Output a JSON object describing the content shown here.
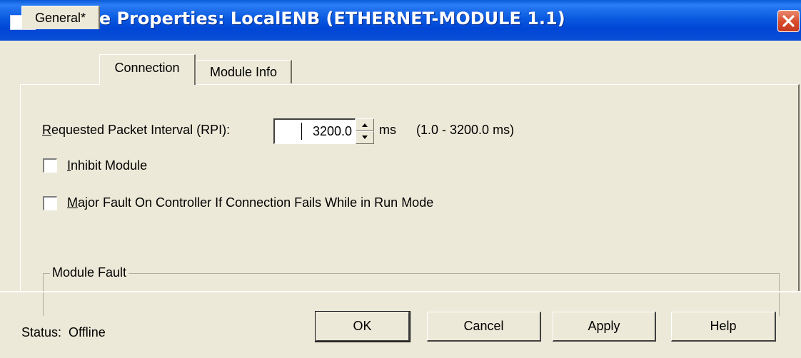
{
  "window": {
    "title": "Module Properties: LocalENB (ETHERNET-MODULE 1.1)"
  },
  "tabs": [
    {
      "label": "General*"
    },
    {
      "label": "Connection"
    },
    {
      "label": "Module Info"
    }
  ],
  "connection": {
    "rpi_label_mnemonic": "R",
    "rpi_label_rest": "equested Packet Interval (RPI):",
    "rpi_value": "3200.0",
    "rpi_unit": "ms",
    "rpi_range": "(1.0 - 3200.0 ms)",
    "inhibit_mnemonic": "I",
    "inhibit_rest": "nhibit Module",
    "inhibit_checked": false,
    "major_fault_mnemonic": "M",
    "major_fault_rest": "ajor Fault On Controller If Connection Fails While in Run Mode",
    "major_fault_checked": false,
    "module_fault_group": "Module Fault"
  },
  "footer": {
    "status_label": "Status:",
    "status_value": "Offline",
    "ok": "OK",
    "cancel": "Cancel",
    "apply": "Apply",
    "help": "Help"
  },
  "icons": {
    "window_icon": "app-window-icon",
    "close": "close-icon",
    "spin_up": "spin-up-icon",
    "spin_down": "spin-down-icon"
  },
  "colors": {
    "titlebar": "#0a5ad8",
    "dialog_bg": "#ece9d8",
    "close_button": "#d94a2b"
  }
}
